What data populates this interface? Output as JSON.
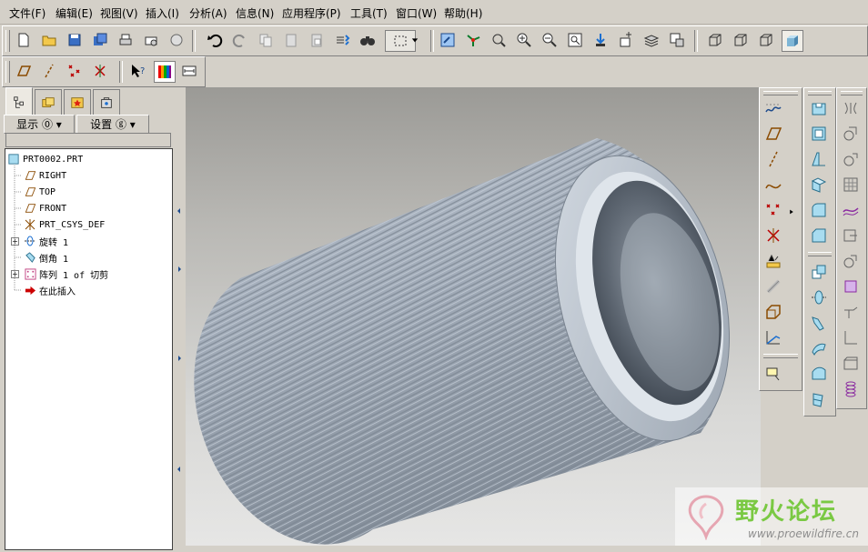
{
  "menu": [
    "文件(F)",
    "编辑(E)",
    "视图(V)",
    "插入(I)",
    "分析(A)",
    "信息(N)",
    "应用程序(P)",
    "工具(T)",
    "窗口(W)",
    "帮助(H)"
  ],
  "left_panel": {
    "show_dropdown": "显示 ⓪ ▾",
    "settings_dropdown": "设置 ⓖ ▾"
  },
  "model_tree": [
    {
      "label": "PRT0002.PRT",
      "icon": "part-icon",
      "expandable": false
    },
    {
      "label": "RIGHT",
      "icon": "datum-plane-icon",
      "expandable": false
    },
    {
      "label": "TOP",
      "icon": "datum-plane-icon",
      "expandable": false
    },
    {
      "label": "FRONT",
      "icon": "datum-plane-icon",
      "expandable": false
    },
    {
      "label": "PRT_CSYS_DEF",
      "icon": "csys-icon",
      "expandable": false
    },
    {
      "label": "旋转 1",
      "icon": "revolve-icon",
      "expandable": true
    },
    {
      "label": "倒角 1",
      "icon": "chamfer-icon",
      "expandable": false
    },
    {
      "label": "阵列 1 of 切剪",
      "icon": "pattern-icon",
      "expandable": true
    },
    {
      "label": "在此插入",
      "icon": "insert-here-arrow-icon",
      "expandable": false
    }
  ],
  "watermark": {
    "title": "野火论坛",
    "url": "www.proewildfire.cn"
  },
  "colors": {
    "window_bg": "#d4d0c8",
    "model_gray": "#a9b3bf",
    "watermark_green": "#7ac943"
  }
}
